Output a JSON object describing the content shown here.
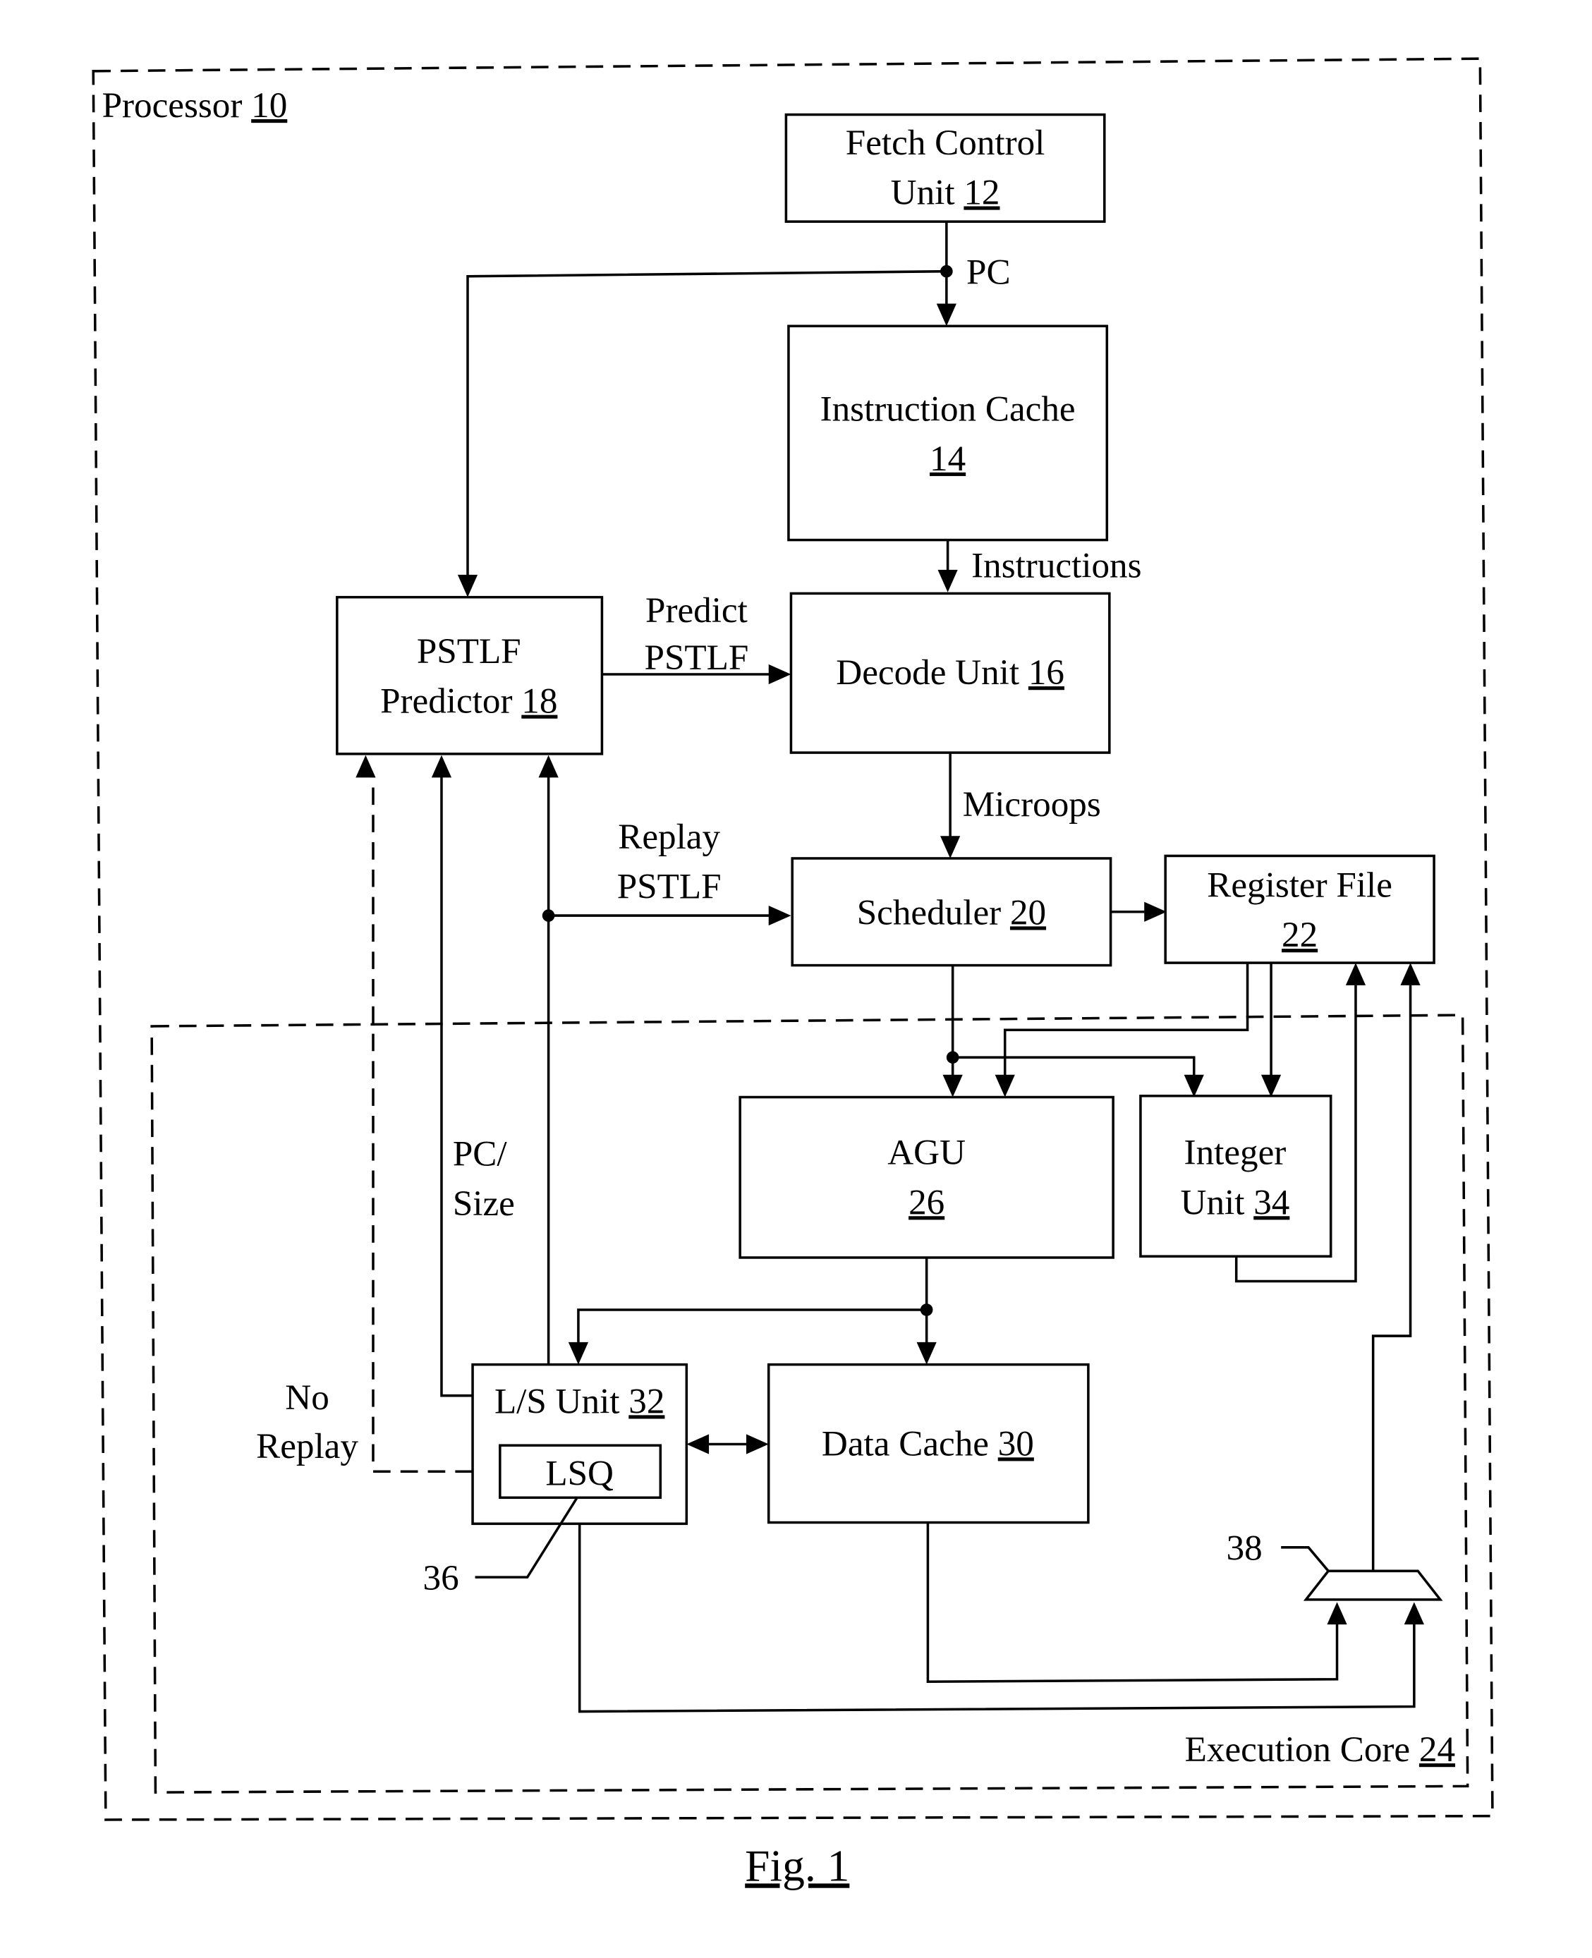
{
  "figure": {
    "caption": "Fig. 1",
    "processor": {
      "label": "Processor",
      "ref": "10"
    },
    "execution_core": {
      "label": "Execution Core",
      "ref": "24"
    },
    "blocks": {
      "fetch_control": {
        "line1": "Fetch Control",
        "line2": "Unit",
        "ref": "12"
      },
      "instruction_cache": {
        "line1": "Instruction Cache",
        "ref": "14"
      },
      "pstlf_predictor": {
        "line1": "PSTLF",
        "line2": "Predictor",
        "ref": "18"
      },
      "decode_unit": {
        "line1": "Decode Unit",
        "ref": "16"
      },
      "scheduler": {
        "line1": "Scheduler",
        "ref": "20"
      },
      "register_file": {
        "line1": "Register File",
        "ref": "22"
      },
      "agu": {
        "line1": "AGU",
        "ref": "26"
      },
      "integer_unit": {
        "line1": "Integer",
        "line2": "Unit",
        "ref": "34"
      },
      "ls_unit": {
        "line1": "L/S Unit",
        "ref": "32"
      },
      "lsq": {
        "line1": "LSQ"
      },
      "data_cache": {
        "line1": "Data Cache",
        "ref": "30"
      }
    },
    "signals": {
      "pc": "PC",
      "instructions": "Instructions",
      "predict_pstlf": {
        "line1": "Predict",
        "line2": "PSTLF"
      },
      "microops": "Microops",
      "replay_pstlf": {
        "line1": "Replay",
        "line2": "PSTLF"
      },
      "pc_size": {
        "line1": "PC/",
        "line2": "Size"
      },
      "no_replay": {
        "line1": "No",
        "line2": "Replay"
      }
    },
    "callouts": {
      "lsq_ref": "36",
      "mux_ref": "38"
    }
  }
}
